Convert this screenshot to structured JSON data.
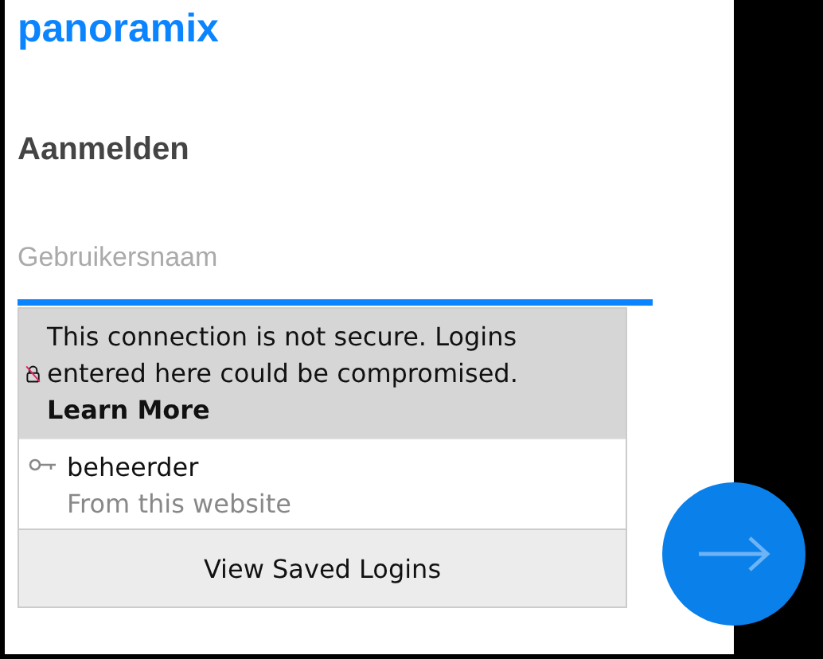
{
  "site_title": "panoramix",
  "heading": "Aanmelden",
  "username_field": {
    "placeholder": "Gebruikersnaam"
  },
  "autocomplete": {
    "warning": "This connection is not secure. Logins entered here could be compromised.",
    "learn_more": "Learn More",
    "logins": [
      {
        "username": "beheerder",
        "origin": "From this website"
      }
    ],
    "footer_button": "View Saved Logins"
  }
}
